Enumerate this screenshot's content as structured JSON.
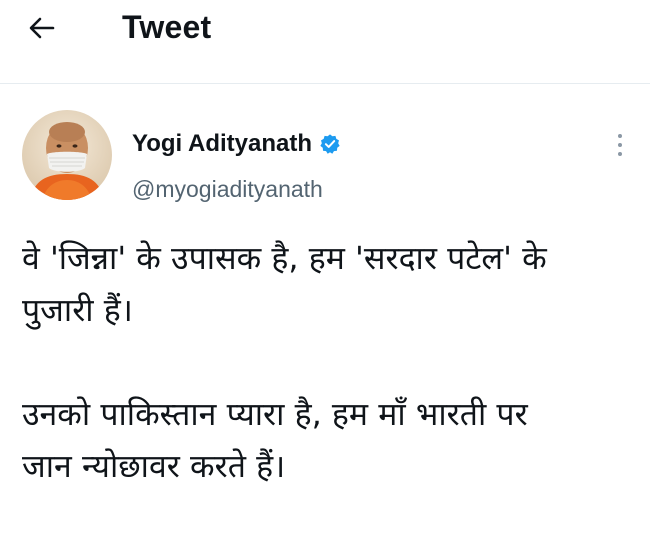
{
  "header": {
    "title": "Tweet",
    "back_icon": "arrow-left-icon"
  },
  "tweet": {
    "author": {
      "name": "Yogi Adityanath",
      "handle": "@myogiadityanath",
      "verified": true,
      "verified_icon": "verified-badge-icon",
      "verified_color": "#1d9bf0"
    },
    "more_icon": "more-vertical-icon",
    "text_lines": [
      "वे 'जिन्ना' के उपासक है, हम 'सरदार पटेल' के",
      "पुजारी हैं।",
      "उनको पाकिस्तान प्यारा है, हम माँ भारती पर",
      "जान न्योछावर करते हैं।"
    ]
  },
  "colors": {
    "text": "#0f1419",
    "secondary": "#536471",
    "divider": "#e6ecf0"
  }
}
